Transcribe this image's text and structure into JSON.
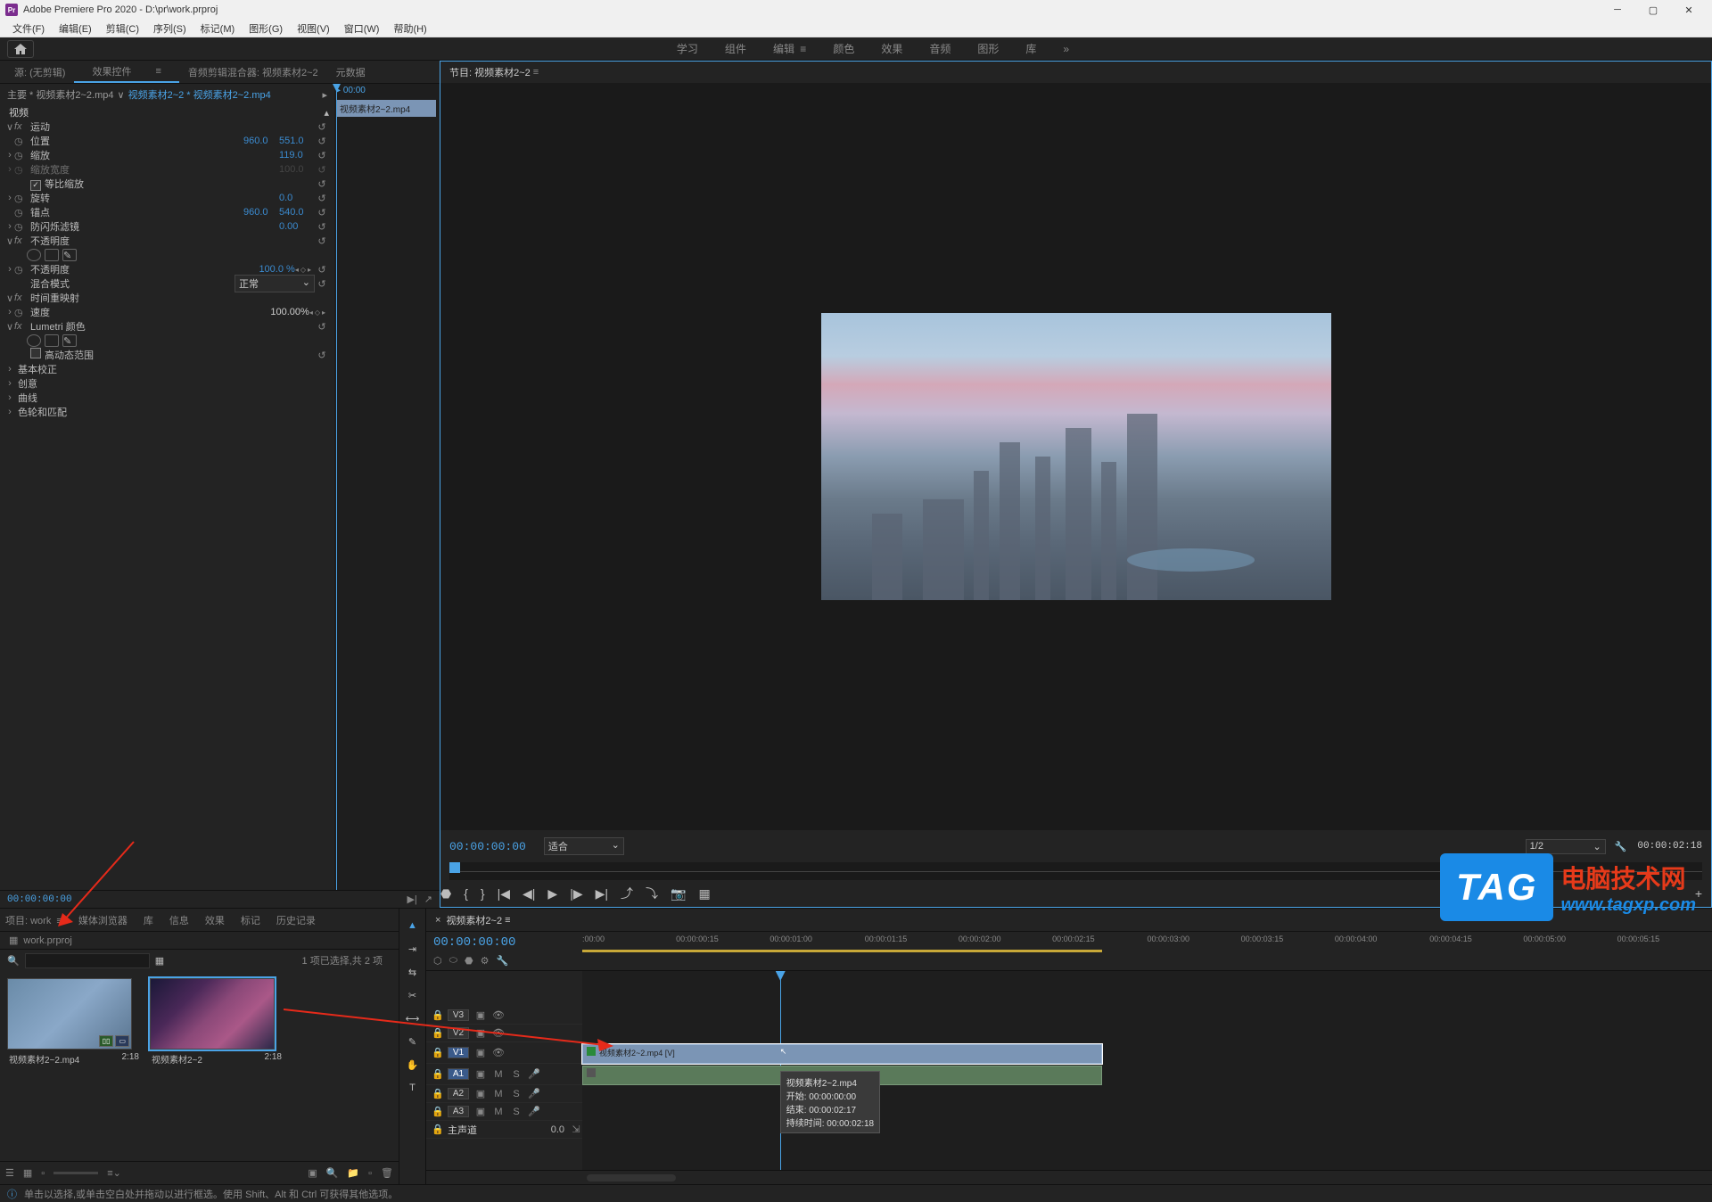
{
  "titlebar": {
    "app_icon_text": "Pr",
    "title": "Adobe Premiere Pro 2020 - D:\\pr\\work.prproj"
  },
  "menubar": [
    "文件(F)",
    "编辑(E)",
    "剪辑(C)",
    "序列(S)",
    "标记(M)",
    "图形(G)",
    "视图(V)",
    "窗口(W)",
    "帮助(H)"
  ],
  "workspace_tabs": [
    "学习",
    "组件",
    "编辑",
    "颜色",
    "效果",
    "音频",
    "图形",
    "库"
  ],
  "workspace_active": "编辑",
  "source_tabs": [
    "源: (无剪辑)",
    "效果控件",
    "音频剪辑混合器: 视频素材2~2",
    "元数据"
  ],
  "source_active": "效果控件",
  "ec": {
    "master_prefix": "主要 * 视频素材2~2.mp4",
    "clip_link": "视频素材2~2 * 视频素材2~2.mp4",
    "video_section": "视频",
    "motion": "运动",
    "position": "位置",
    "position_x": "960.0",
    "position_y": "551.0",
    "scale": "缩放",
    "scale_val": "119.0",
    "scale_width": "缩放宽度",
    "scale_width_val": "100.0",
    "uniform_scale": "等比缩放",
    "rotation": "旋转",
    "rotation_val": "0.0",
    "anchor": "锚点",
    "anchor_x": "960.0",
    "anchor_y": "540.0",
    "antiflicker": "防闪烁滤镜",
    "antiflicker_val": "0.00",
    "opacity": "不透明度",
    "opacity_val": "100.0 %",
    "blend_mode": "混合模式",
    "blend_mode_val": "正常",
    "time_remap": "时间重映射",
    "speed": "速度",
    "speed_val": "100.00%",
    "lumetri": "Lumetri 颜色",
    "hdr": "高动态范围",
    "basic_correction": "基本校正",
    "creative": "创意",
    "curves": "曲线",
    "color_wheels": "色轮和匹配",
    "right_tc": "00:00",
    "right_clip_name": "视频素材2~2.mp4",
    "footer_tc": "00:00:00:00"
  },
  "program": {
    "header": "节目: 视频素材2~2",
    "tc": "00:00:00:00",
    "fit": "适合",
    "page": "1/2",
    "duration": "00:00:02:18"
  },
  "project": {
    "tabs": [
      "项目: work",
      "媒体浏览器",
      "库",
      "信息",
      "效果",
      "标记",
      "历史记录"
    ],
    "active_tab": "项目: work",
    "sub": "work.prproj",
    "selection_info": "1 项已选择,共 2 项",
    "items": [
      {
        "name": "视频素材2~2.mp4",
        "dur": "2:18"
      },
      {
        "name": "视频素材2~2",
        "dur": "2:18"
      }
    ]
  },
  "timeline": {
    "header": "视频素材2~2",
    "tc": "00:00:00:00",
    "ticks": [
      ":00:00",
      "00:00:00:15",
      "00:00:01:00",
      "00:00:01:15",
      "00:00:02:00",
      "00:00:02:15",
      "00:00:03:00",
      "00:00:03:15",
      "00:00:04:00",
      "00:00:04:15",
      "00:00:05:00",
      "00:00:05:15"
    ],
    "tracks_v": [
      "V3",
      "V2",
      "V1"
    ],
    "tracks_a": [
      "A1",
      "A2",
      "A3"
    ],
    "master": "主声道",
    "master_val": "0.0",
    "clip_name": "视频素材2~2.mp4 [V]",
    "tooltip": {
      "name": "视频素材2~2.mp4",
      "start_label": "开始:",
      "start": "00:00:00:00",
      "end_label": "结束:",
      "end": "00:00:02:17",
      "dur_label": "持续时间:",
      "dur": "00:00:02:18"
    }
  },
  "statusbar": "单击以选择,或单击空白处并拖动以进行框选。使用 Shift、Alt 和 Ctrl 可获得其他选项。",
  "watermark": {
    "tag": "TAG",
    "cn": "电脑技术网",
    "url": "www.tagxp.com"
  }
}
